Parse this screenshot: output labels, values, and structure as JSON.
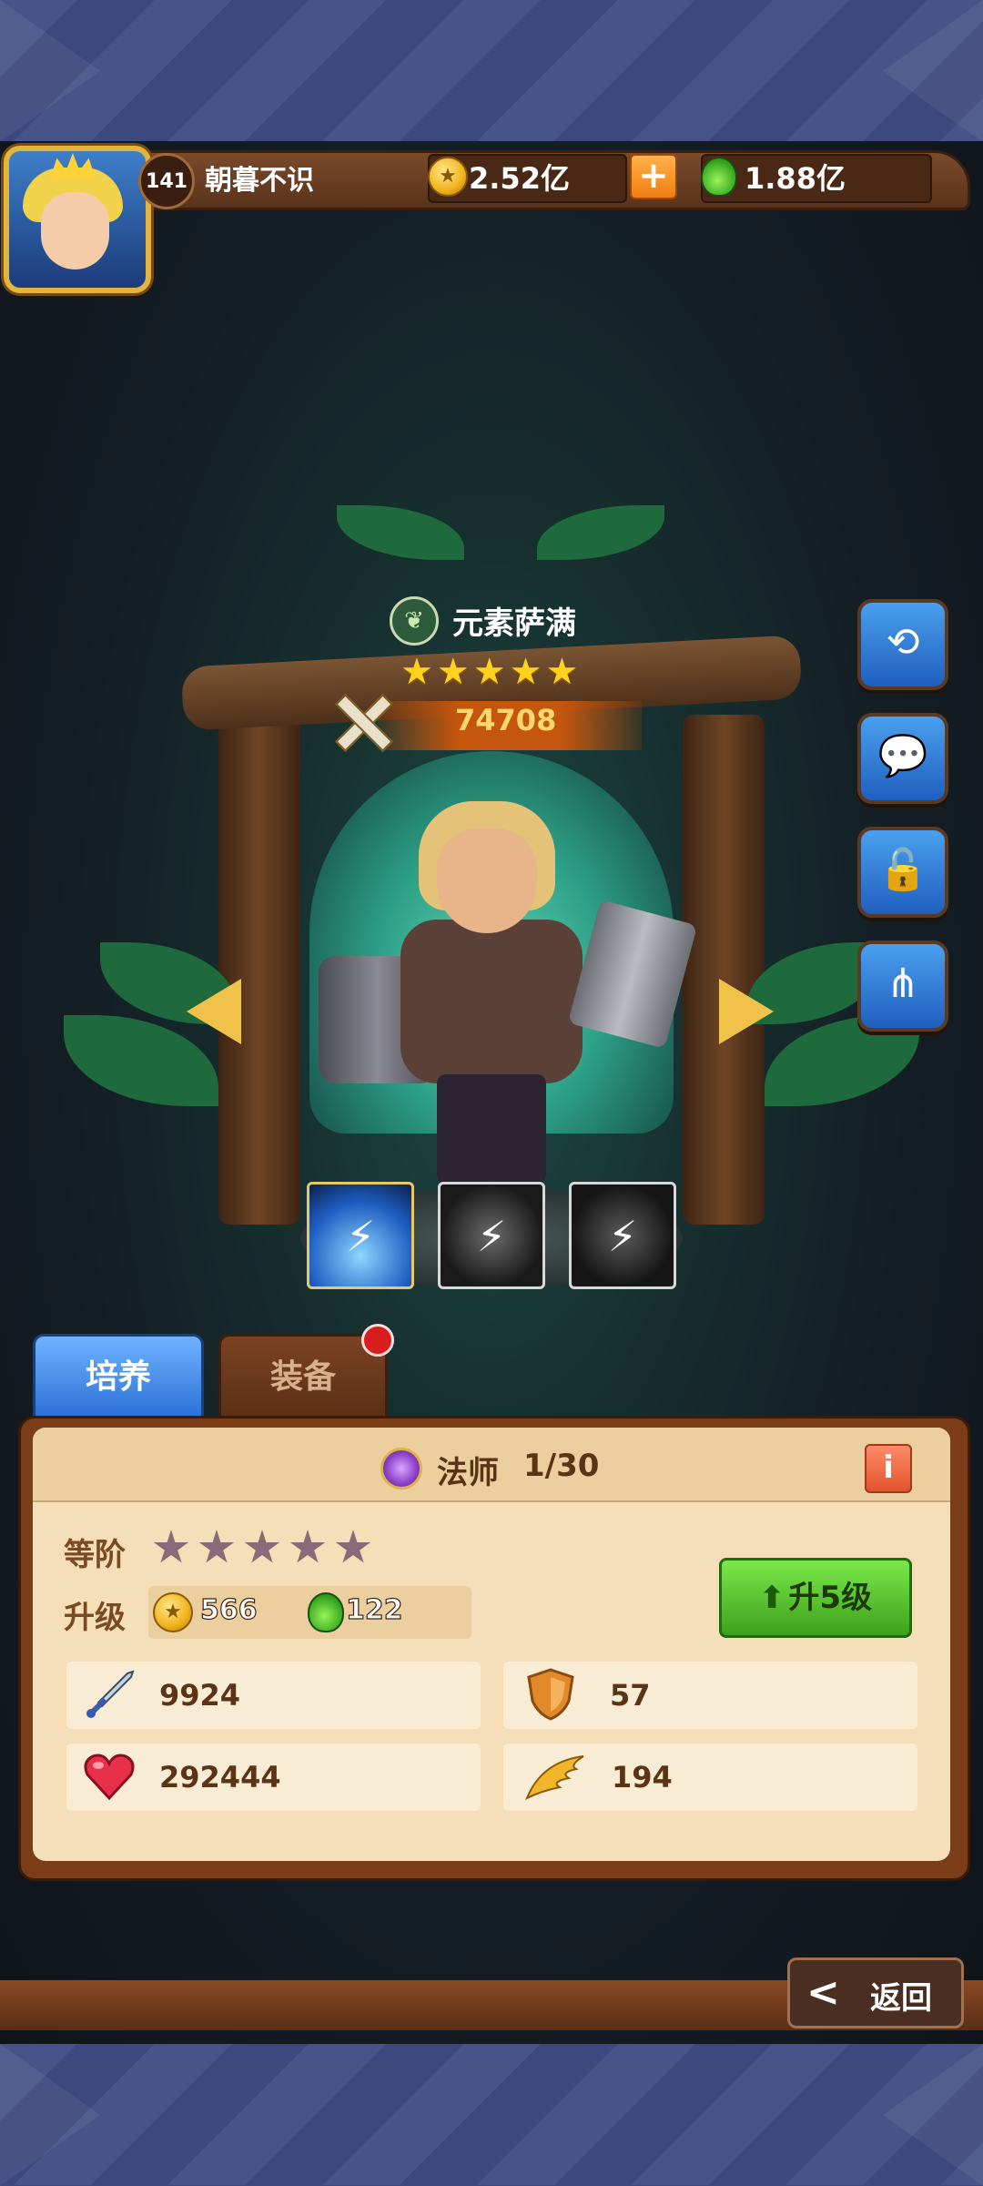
{
  "player": {
    "level": "141",
    "name": "朝暮不识",
    "gold": "2.52亿",
    "potion": "1.88亿",
    "plus_label": "+"
  },
  "hero": {
    "name": "元素萨满",
    "stars": "★★★★★",
    "power": "74708",
    "element_icon": "leaf-icon"
  },
  "side_buttons": [
    {
      "name": "refresh-icon",
      "glyph": "⟲"
    },
    {
      "name": "chat-icon",
      "glyph": "💬"
    },
    {
      "name": "lock-icon",
      "glyph": "🔓"
    },
    {
      "name": "share-icon",
      "glyph": "⋔"
    }
  ],
  "skills": [
    {
      "name": "skill-lightning-storm",
      "glyph": "⚡"
    },
    {
      "name": "skill-thunder-strike",
      "glyph": "⚡"
    },
    {
      "name": "skill-thunder-bull",
      "glyph": "⚡"
    }
  ],
  "tabs": {
    "train": "培养",
    "equip": "装备"
  },
  "panel": {
    "class_name": "法师",
    "class_count": "1/30",
    "info_label": "i",
    "rank_label": "等阶",
    "rank_stars_total": 5,
    "upgrade_label": "升级",
    "cost_gold": "566",
    "cost_potion": "122",
    "upgrade_button": "升5级",
    "stats": {
      "attack": "9924",
      "defense": "57",
      "hp": "292444",
      "speed": "194"
    }
  },
  "back_label": "返回",
  "colors": {
    "tab_active": "#2a6fd6",
    "upgrade_green": "#3da11b",
    "gold": "#f1b21c",
    "potion_green": "#34a81e"
  }
}
